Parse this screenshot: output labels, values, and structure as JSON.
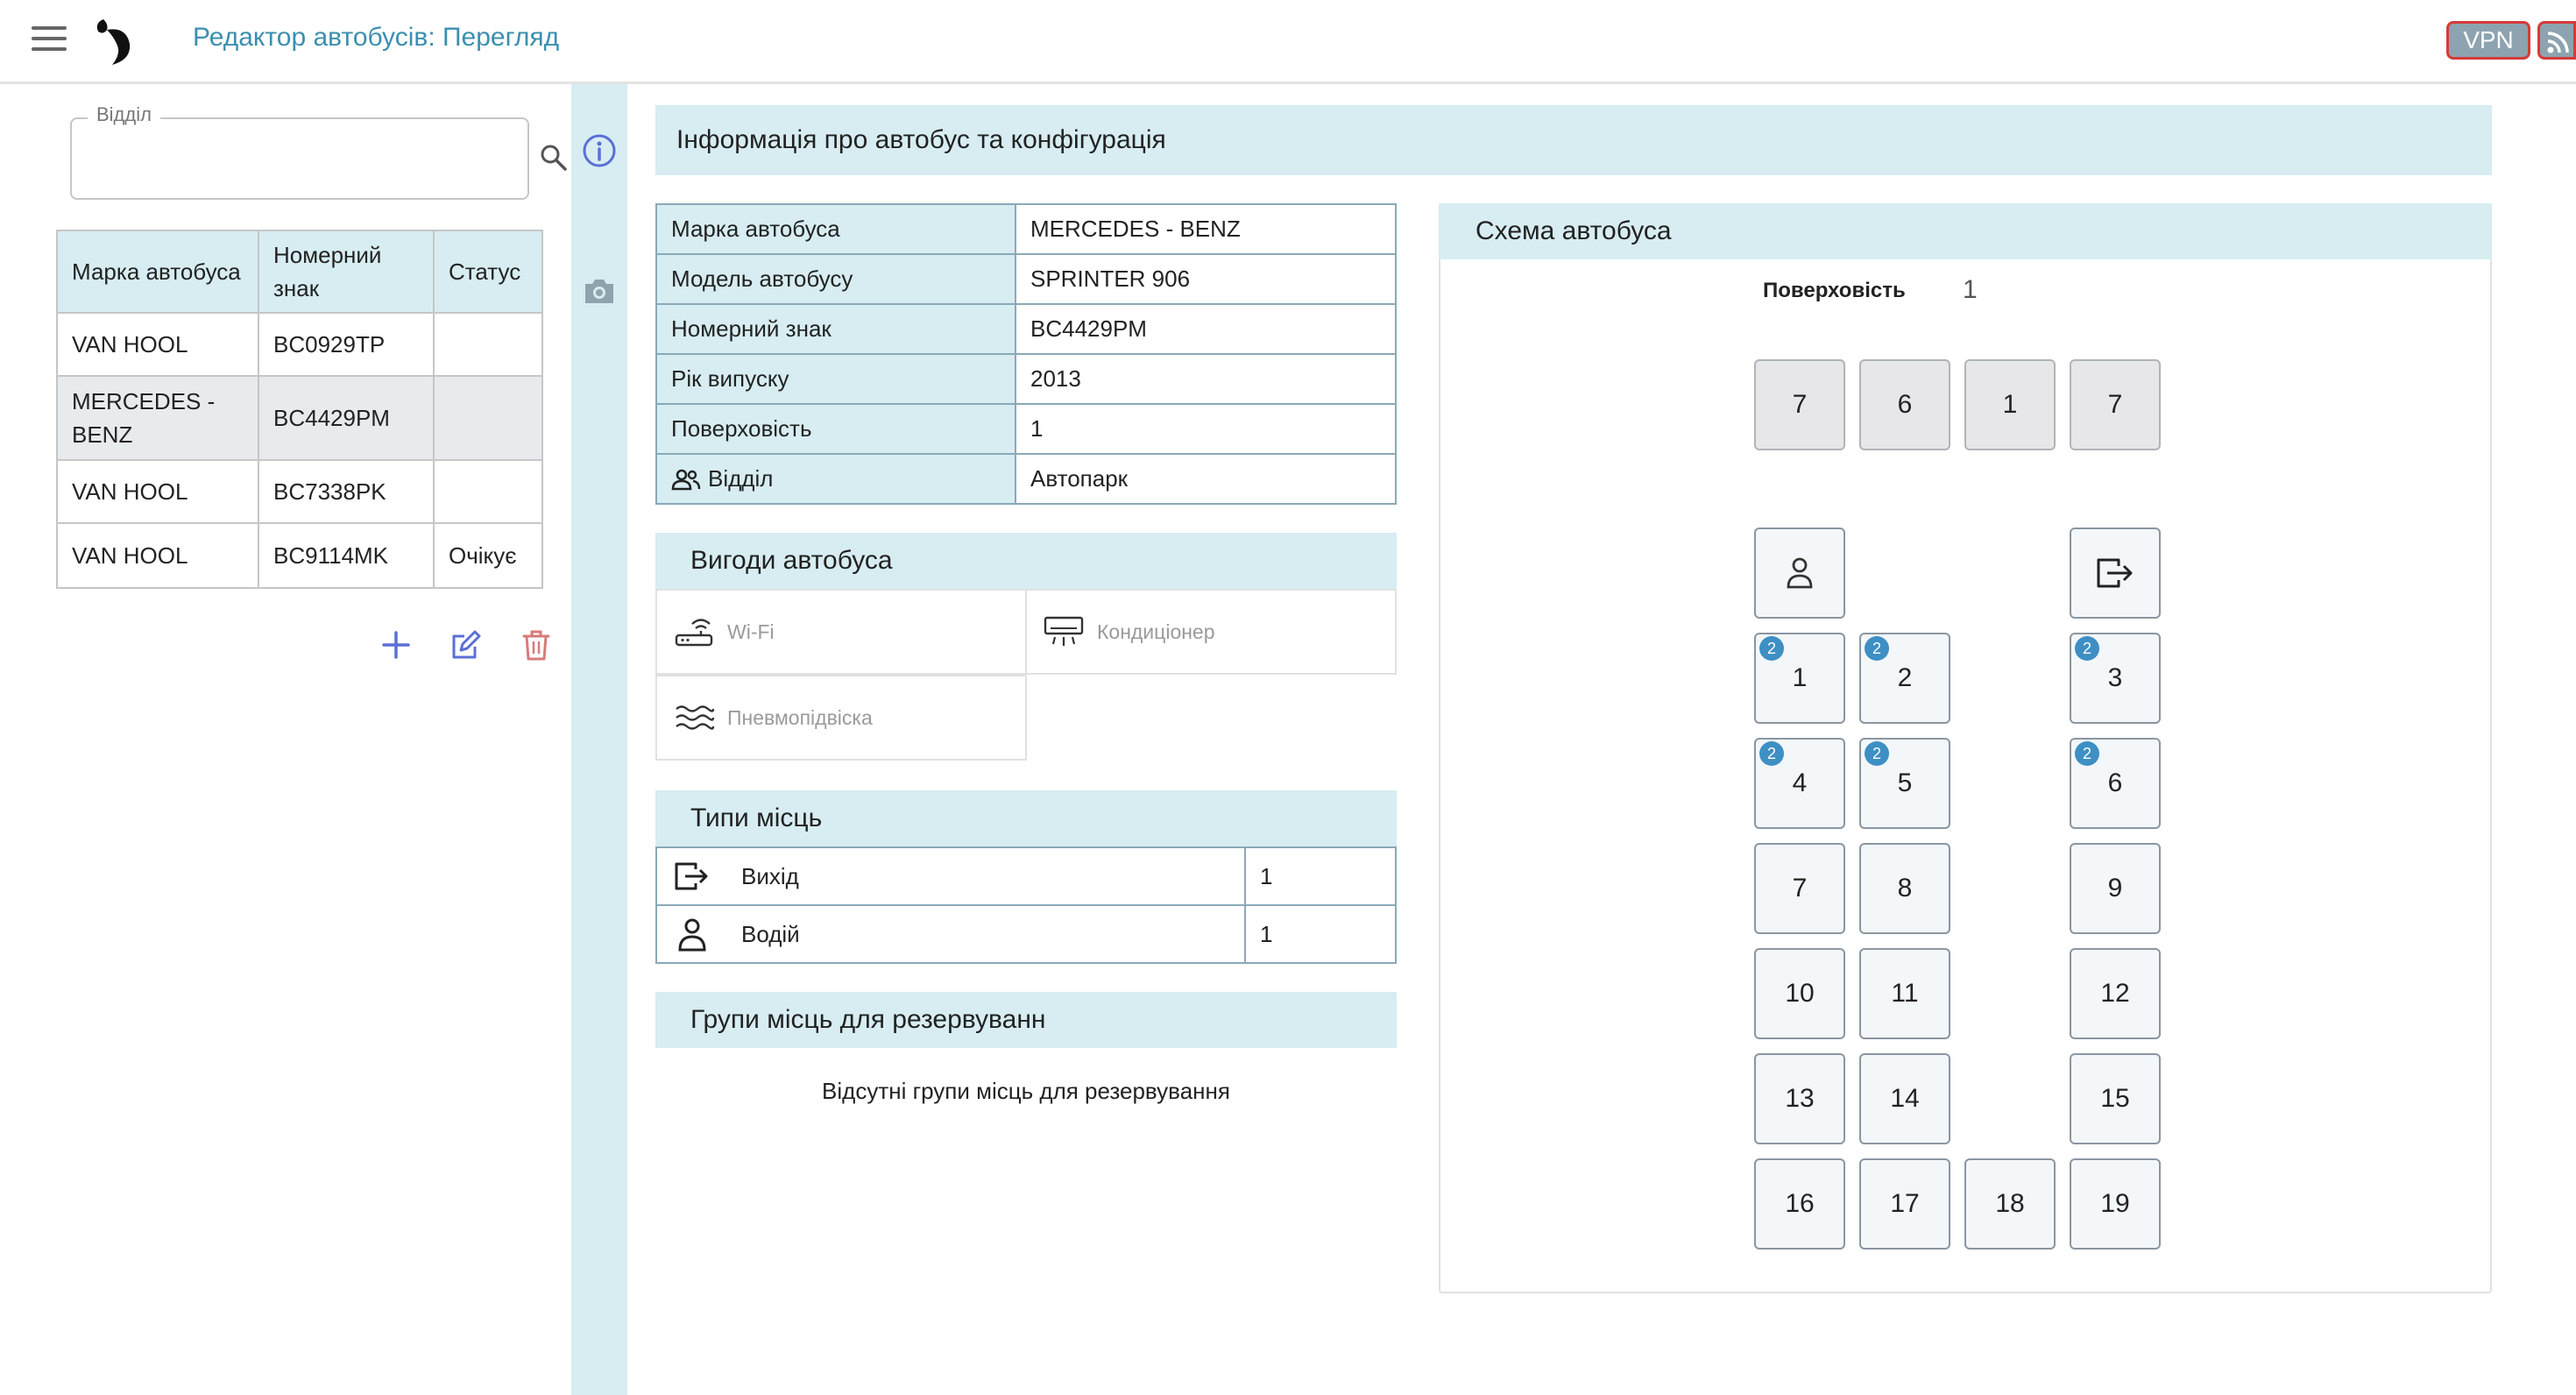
{
  "header": {
    "title": "Редактор автобусів: Перегляд",
    "vpn_label": "VPN"
  },
  "filter": {
    "legend": "Відділ",
    "value": ""
  },
  "bus_list": {
    "columns": [
      "Марка автобуса",
      "Номерний знак",
      "Статус"
    ],
    "rows": [
      {
        "brand": "VAN HOOL",
        "plate": "BC0929TP",
        "status": ""
      },
      {
        "brand": "MERCEDES - BENZ",
        "plate": "BC4429PM",
        "status": ""
      },
      {
        "brand": "VAN HOOL",
        "plate": "BC7338PK",
        "status": ""
      },
      {
        "brand": "VAN HOOL",
        "plate": "BC9114MK",
        "status": "Очікує"
      }
    ]
  },
  "main": {
    "title": "Інформація про автобус та конфігурація",
    "specs": [
      {
        "label": "Марка автобуса",
        "value": "MERCEDES - BENZ"
      },
      {
        "label": "Модель автобусу",
        "value": "SPRINTER 906"
      },
      {
        "label": "Номерний знак",
        "value": "BC4429PM"
      },
      {
        "label": "Рік випуску",
        "value": "2013"
      },
      {
        "label": "Поверховість",
        "value": "1"
      },
      {
        "label": "Відділ",
        "value": "Автопарк"
      }
    ],
    "amenities_title": "Вигоди автобуса",
    "amenities": [
      {
        "label": "Wi-Fi"
      },
      {
        "label": "Кондиціонер"
      },
      {
        "label": "Пневмопідвіска"
      }
    ],
    "seat_types_title": "Типи місць",
    "seat_types": [
      {
        "label": "Вихід",
        "count": "1"
      },
      {
        "label": "Водій",
        "count": "1"
      }
    ],
    "groups_title": "Групи місць для резервуванн",
    "groups_empty": "Відсутні групи місць для резервування"
  },
  "scheme": {
    "title": "Схема автобуса",
    "floor_label": "Поверховість",
    "floor_value": "1",
    "top_row": [
      "7",
      "6",
      "1",
      "7"
    ],
    "seats": [
      {
        "label": "1",
        "badge": "2"
      },
      {
        "label": "2",
        "badge": "2"
      },
      {
        "label": "3",
        "badge": "2"
      },
      {
        "label": "4",
        "badge": "2"
      },
      {
        "label": "5",
        "badge": "2"
      },
      {
        "label": "6",
        "badge": "2"
      },
      {
        "label": "7",
        "badge": ""
      },
      {
        "label": "8",
        "badge": ""
      },
      {
        "label": "9",
        "badge": ""
      },
      {
        "label": "10",
        "badge": ""
      },
      {
        "label": "11",
        "badge": ""
      },
      {
        "label": "12",
        "badge": ""
      },
      {
        "label": "13",
        "badge": ""
      },
      {
        "label": "14",
        "badge": ""
      },
      {
        "label": "15",
        "badge": ""
      },
      {
        "label": "16",
        "badge": ""
      },
      {
        "label": "17",
        "badge": ""
      },
      {
        "label": "18",
        "badge": ""
      },
      {
        "label": "19",
        "badge": ""
      }
    ]
  },
  "colors": {
    "accent": "#3b8fb0",
    "header_bg": "#d7edf2",
    "badge": "#3e8fc4",
    "danger": "#d63a3a"
  }
}
